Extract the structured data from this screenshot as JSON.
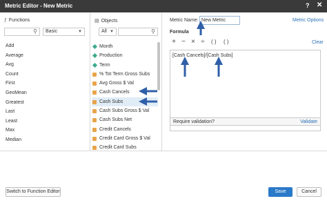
{
  "window": {
    "title": "Metric Editor - New Metric",
    "help_label": "?",
    "close_label": "✕"
  },
  "functions": {
    "header": "Functions",
    "category": "Basic",
    "items": [
      "Add",
      "Average",
      "Avg",
      "Count",
      "First",
      "GeoMean",
      "Greatest",
      "Last",
      "Least",
      "Max",
      "Median"
    ]
  },
  "objects": {
    "header": "Objects",
    "filter": "All",
    "items": [
      {
        "label": "Month",
        "kind": "attribute"
      },
      {
        "label": "Production",
        "kind": "attribute"
      },
      {
        "label": "Term",
        "kind": "attribute"
      },
      {
        "label": "% Tot Term Gross Subs",
        "kind": "metric"
      },
      {
        "label": "Avg Gross $ Val",
        "kind": "metric"
      },
      {
        "label": "Cash Cancels",
        "kind": "metric"
      },
      {
        "label": "Cash Subs",
        "kind": "metric"
      },
      {
        "label": "Cash Subs Gross $ Val",
        "kind": "metric"
      },
      {
        "label": "Cash Subs Net",
        "kind": "metric"
      },
      {
        "label": "Credit Cancels",
        "kind": "metric"
      },
      {
        "label": "Credit Card Gross $ Val",
        "kind": "metric"
      },
      {
        "label": "Credit Card Subs",
        "kind": "metric"
      }
    ],
    "selected_index": 6
  },
  "metric": {
    "name_label": "Metric Name:",
    "name_value": "New Metric",
    "options_link": "Metric Options",
    "formula_label": "Formula",
    "operators": [
      "+",
      "−",
      "×",
      "÷",
      "( )",
      "( )"
    ],
    "clear_link": "Clear",
    "formula": "[Cash Cancels]/[Cash Subs]",
    "require_validation": "Require validation?",
    "validate_link": "Validate"
  },
  "footer": {
    "switch_button": "Switch to Function Editor",
    "save_button": "Save",
    "cancel_button": "Cancel"
  },
  "colors": {
    "title_bg": "#3a3a3a",
    "accent": "#2b79c9",
    "annotation_arrow": "#2f5fa8",
    "attribute_icon": "#3daa8c",
    "metric_icon": "#e8a44a"
  }
}
